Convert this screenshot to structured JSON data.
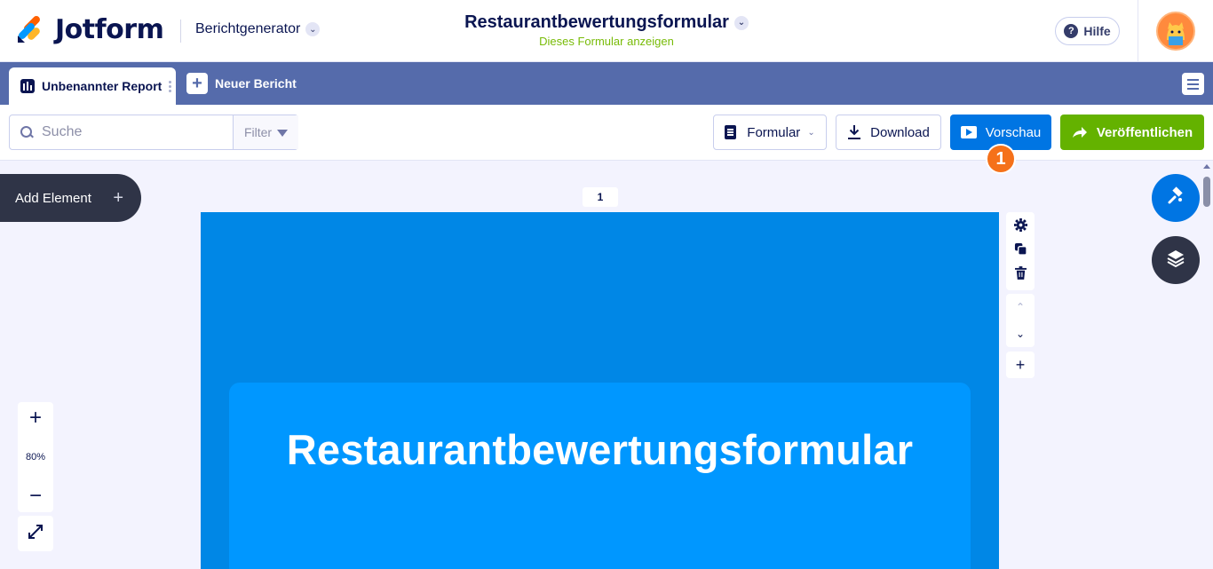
{
  "header": {
    "brand": "Jotform",
    "app_switcher": "Berichtgenerator",
    "form_title": "Restaurantbewertungsformular",
    "form_link": "Dieses Formular anzeigen",
    "help_label": "Hilfe"
  },
  "tabs": {
    "active_tab": "Unbenannter Report",
    "new_report": "Neuer Bericht"
  },
  "toolbar": {
    "search_placeholder": "Suche",
    "filter_label": "Filter",
    "form_label": "Formular",
    "download_label": "Download",
    "preview_label": "Vorschau",
    "publish_label": "Veröffentlichen",
    "step_badge": "1"
  },
  "canvas": {
    "add_element_label": "Add Element",
    "page_number": "1",
    "title_text": "Restaurantbewertungsformular",
    "zoom_level": "80%"
  },
  "colors": {
    "primary_blue": "#0075e3",
    "publish_green": "#64b200",
    "tabbar": "#556bab",
    "badge_orange": "#f5711a",
    "page_bg": "#0087e6"
  },
  "icons": [
    "jotform-logo-icon",
    "chevron-down-icon",
    "help-icon",
    "avatar",
    "report-icon",
    "plus-icon",
    "menu-icon",
    "search-icon",
    "filter-icon",
    "form-icon",
    "download-icon",
    "preview-play-icon",
    "share-arrow-icon",
    "gear-icon",
    "duplicate-icon",
    "trash-icon",
    "chevron-up-icon",
    "paint-roller-icon",
    "layers-icon",
    "fullscreen-icon"
  ]
}
